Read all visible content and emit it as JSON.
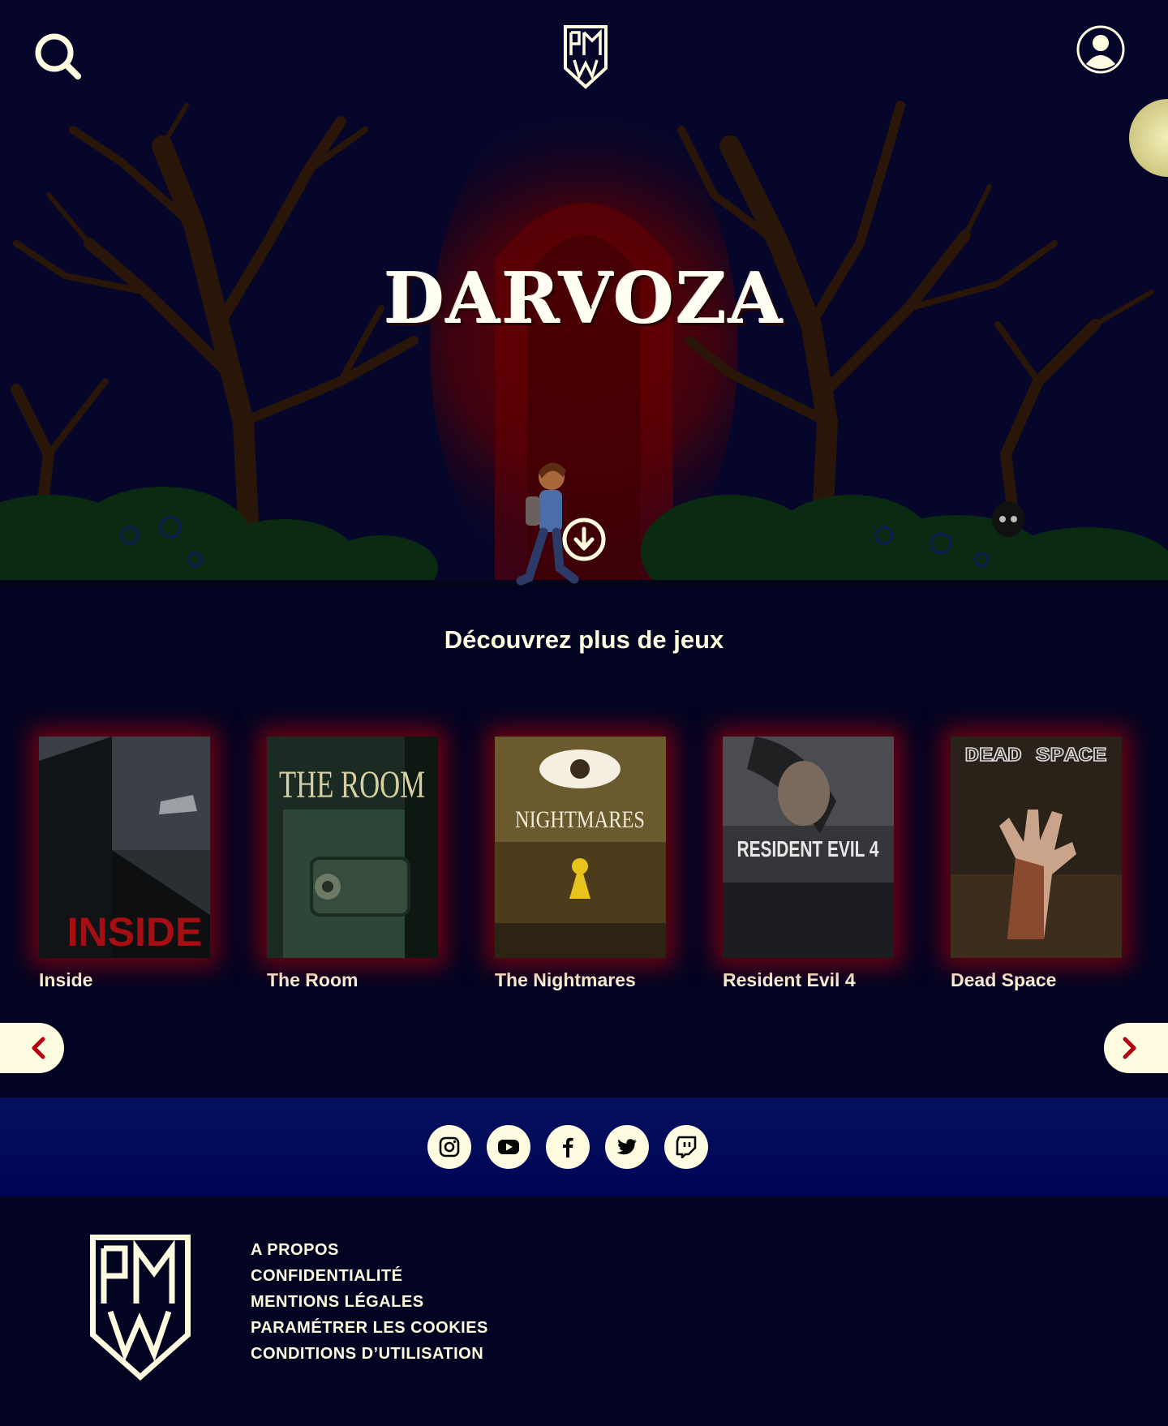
{
  "header": {
    "search_icon": "search-icon",
    "logo_icon": "iamwa-shield-logo",
    "profile_icon": "user-profile-icon"
  },
  "hero": {
    "title": "DARVOZA",
    "scroll_icon": "arrow-down-circle-icon"
  },
  "games": {
    "section_title": "Découvrez plus de jeux",
    "items": [
      {
        "title": "Inside",
        "cover_text": "INSIDE"
      },
      {
        "title": "The Room",
        "cover_text": "THE ROOM"
      },
      {
        "title": "The Nightmares",
        "cover_text": "NIGHTMARES"
      },
      {
        "title": "Resident Evil 4",
        "cover_text": "RESIDENT EVIL 4"
      },
      {
        "title": "Dead Space",
        "cover_text": "DEAD SPACE"
      }
    ],
    "prev_icon": "chevron-left-icon",
    "next_icon": "chevron-right-icon"
  },
  "social": {
    "items": [
      "instagram-icon",
      "youtube-icon",
      "facebook-icon",
      "twitter-icon",
      "twitch-icon"
    ]
  },
  "footer": {
    "links": [
      "A PROPOS",
      "CONFIDENTIALITÉ",
      "MENTIONS LÉGALES",
      "PARAMÉTRER LES COOKIES",
      "CONDITIONS D’UTILISATION"
    ]
  },
  "colors": {
    "background": "#030422",
    "cream": "#fffbe0",
    "social_band": "#03115e",
    "accent_red": "#c1000f"
  }
}
